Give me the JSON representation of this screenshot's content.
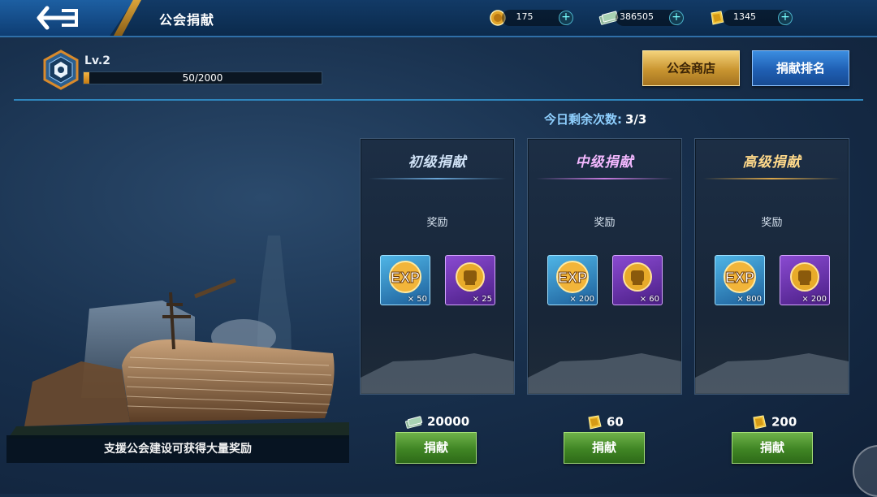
{
  "header": {
    "title": "公会捐献"
  },
  "resources": [
    {
      "icon": "guild-coin-icon",
      "value": "175"
    },
    {
      "icon": "cash-icon",
      "value": "386505"
    },
    {
      "icon": "gold-bar-icon",
      "value": "1345"
    }
  ],
  "level": {
    "label": "Lv.2",
    "progress_text": "50/2000",
    "progress_fraction": 0.025
  },
  "buttons": {
    "shop": "公会商店",
    "ranking": "捐献排名"
  },
  "remaining": {
    "label": "今日剩余次数:",
    "value": "3/3"
  },
  "tip": "支援公会建设可获得大量奖励",
  "reward_label": "奖励",
  "cards": [
    {
      "title": "初级捐献",
      "title_color": "#cfe1f5",
      "line_color": "#6aa6d8",
      "rewards": [
        {
          "icon": "exp-icon",
          "count": "× 50"
        },
        {
          "icon": "fist-medal-icon",
          "count": "× 25"
        }
      ],
      "cost_icon": "cash-icon",
      "cost": "20000",
      "button": "捐献"
    },
    {
      "title": "中级捐献",
      "title_color": "#f3b8ff",
      "line_color": "#c77bdf",
      "rewards": [
        {
          "icon": "exp-icon",
          "count": "× 200"
        },
        {
          "icon": "fist-medal-icon",
          "count": "× 60"
        }
      ],
      "cost_icon": "gold-bar-icon",
      "cost": "60",
      "button": "捐献"
    },
    {
      "title": "高级捐献",
      "title_color": "#ffd98a",
      "line_color": "#d9a64a",
      "rewards": [
        {
          "icon": "exp-icon",
          "count": "× 800"
        },
        {
          "icon": "fist-medal-icon",
          "count": "× 200"
        }
      ],
      "cost_icon": "gold-bar-icon",
      "cost": "200",
      "button": "捐献"
    }
  ],
  "colors": {
    "accent_gold": "#c99530",
    "accent_blue": "#1f5fb3",
    "donate_green": "#3f8524"
  }
}
